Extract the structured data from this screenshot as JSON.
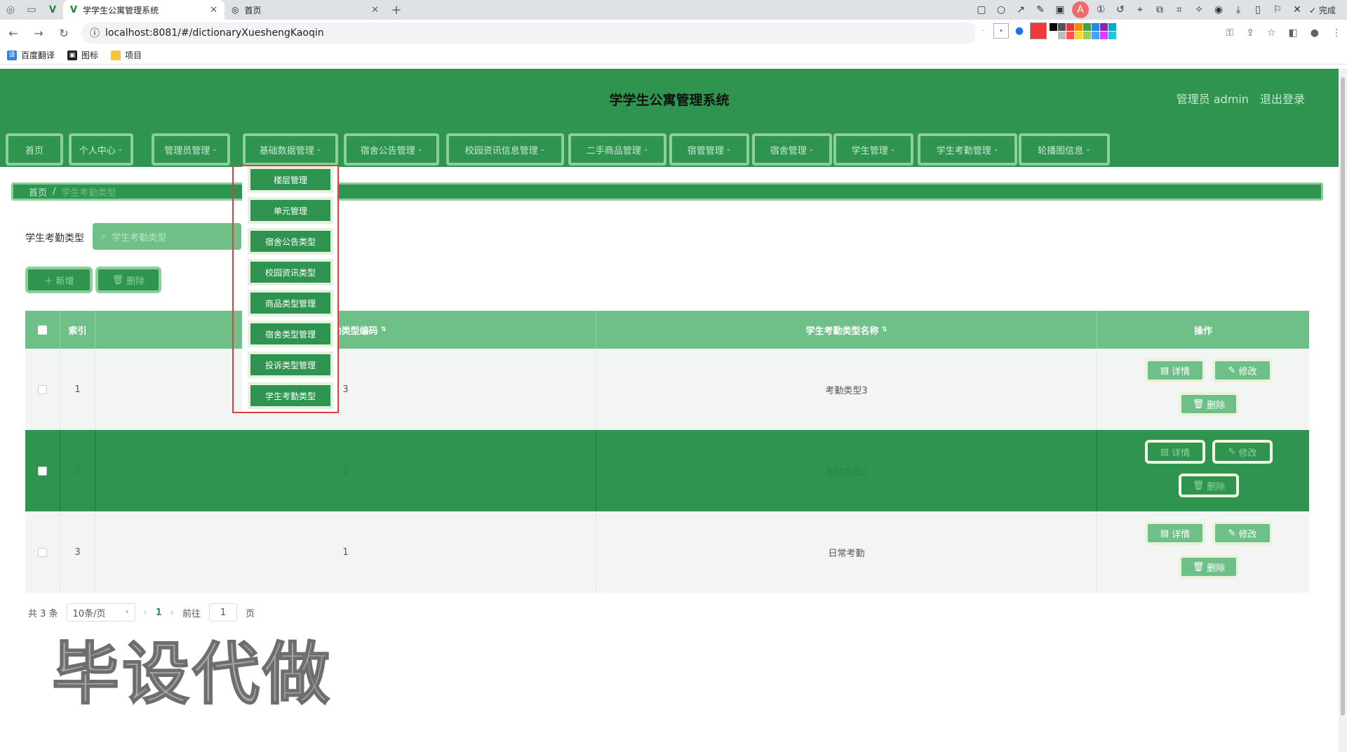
{
  "browser": {
    "tabs": [
      {
        "title": "学学生公寓管理系统",
        "active": true
      },
      {
        "title": "首页",
        "active": false
      }
    ],
    "url": "localhost:8081/#/dictionaryXueshengKaoqin",
    "annotation_toolbar": {
      "done_label": "完成"
    },
    "bookmarks": [
      "百度翻译",
      "图标",
      "项目"
    ],
    "palette_current": "#f03a3a",
    "palette_swatches": [
      "#000000",
      "#555555",
      "#e53935",
      "#fb8c00",
      "#43a047",
      "#1e88e5",
      "#8e24aa",
      "#00acc1",
      "#ffffff",
      "#bdbdbd",
      "#ff5252",
      "#fdd835",
      "#9ccc65",
      "#42a5f5",
      "#e040fb",
      "#26c6da"
    ]
  },
  "header": {
    "title": "学学生公寓管理系统",
    "user": "管理员 admin",
    "logout": "退出登录"
  },
  "menu": [
    {
      "label": "首页",
      "chevron": false
    },
    {
      "label": "个人中心",
      "chevron": true
    },
    {
      "label": "管理员管理",
      "chevron": true
    },
    {
      "label": "基础数据管理",
      "chevron": true
    },
    {
      "label": "宿舍公告管理",
      "chevron": true
    },
    {
      "label": "校园资讯信息管理",
      "chevron": true
    },
    {
      "label": "二手商品管理",
      "chevron": true
    },
    {
      "label": "宿管管理",
      "chevron": true
    },
    {
      "label": "宿舍管理",
      "chevron": true
    },
    {
      "label": "学生管理",
      "chevron": true
    },
    {
      "label": "学生考勤管理",
      "chevron": true
    },
    {
      "label": "轮播图信息",
      "chevron": true
    }
  ],
  "dropdown": [
    "楼层管理",
    "单元管理",
    "宿舍公告类型",
    "校园资讯类型",
    "商品类型管理",
    "宿舍类型管理",
    "投诉类型管理",
    "学生考勤类型"
  ],
  "breadcrumb": {
    "home": "首页",
    "separator": "/",
    "current": "学生考勤类型"
  },
  "search": {
    "label": "学生考勤类型",
    "placeholder": "学生考勤类型"
  },
  "toolbar": {
    "add": "新增",
    "delete": "删除"
  },
  "table": {
    "headers": {
      "index": "索引",
      "code": "学生考勤类型编码",
      "name": "学生考勤类型名称",
      "actions": "操作"
    },
    "rows": [
      {
        "index": "1",
        "code": "3",
        "name": "考勤类型3"
      },
      {
        "index": "2",
        "code": "2",
        "name": "考勤类型2"
      },
      {
        "index": "3",
        "code": "1",
        "name": "日常考勤"
      }
    ],
    "actions": {
      "detail": "详情",
      "edit": "修改",
      "delete": "删除"
    }
  },
  "pagination": {
    "total": "共 3 条",
    "page_size": "10条/页",
    "current": "1",
    "goto_prefix": "前往",
    "goto_value": "1",
    "goto_suffix": "页"
  },
  "watermark": "毕设代做"
}
